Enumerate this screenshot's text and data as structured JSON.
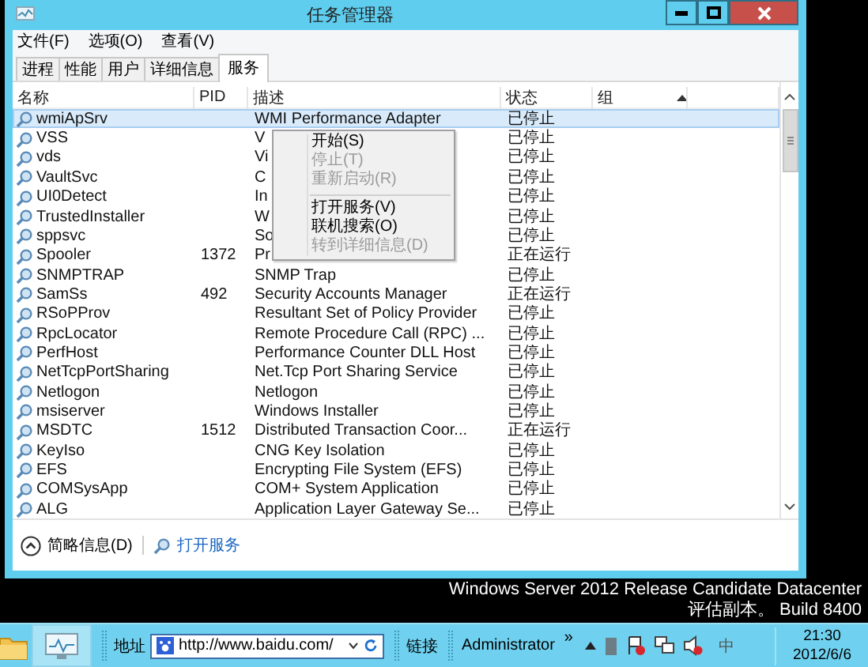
{
  "window": {
    "title": "任务管理器"
  },
  "menu": [
    "文件(F)",
    "选项(O)",
    "查看(V)"
  ],
  "tabs": [
    {
      "label": "进程",
      "selected": false
    },
    {
      "label": "性能",
      "selected": false
    },
    {
      "label": "用户",
      "selected": false
    },
    {
      "label": "详细信息",
      "selected": false
    },
    {
      "label": "服务",
      "selected": true
    }
  ],
  "table": {
    "columns": [
      {
        "label": "名称",
        "sorted": false
      },
      {
        "label": "PID",
        "sorted": false
      },
      {
        "label": "描述",
        "sorted": false
      },
      {
        "label": "状态",
        "sorted": false
      },
      {
        "label": "组",
        "sorted": true
      }
    ],
    "rows": [
      {
        "name": "wmiApSrv",
        "pid": "",
        "description": "WMI Performance Adapter",
        "status": "已停止",
        "selected": true
      },
      {
        "name": "VSS",
        "pid": "",
        "description": "V",
        "status": "已停止",
        "selected": false
      },
      {
        "name": "vds",
        "pid": "",
        "description": "Vi",
        "status": "已停止",
        "selected": false
      },
      {
        "name": "VaultSvc",
        "pid": "",
        "description": "C",
        "status": "已停止",
        "selected": false
      },
      {
        "name": "UI0Detect",
        "pid": "",
        "description": "In",
        "status": "已停止",
        "selected": false
      },
      {
        "name": "TrustedInstaller",
        "pid": "",
        "description": "W",
        "status": "已停止",
        "selected": false
      },
      {
        "name": "sppsvc",
        "pid": "",
        "description": "So",
        "status": "已停止",
        "selected": false
      },
      {
        "name": "Spooler",
        "pid": "1372",
        "description": "Pr",
        "status": "正在运行",
        "selected": false
      },
      {
        "name": "SNMPTRAP",
        "pid": "",
        "description": "SNMP Trap",
        "status": "已停止",
        "selected": false
      },
      {
        "name": "SamSs",
        "pid": "492",
        "description": "Security Accounts Manager",
        "status": "正在运行",
        "selected": false
      },
      {
        "name": "RSoPProv",
        "pid": "",
        "description": "Resultant Set of Policy Provider",
        "status": "已停止",
        "selected": false
      },
      {
        "name": "RpcLocator",
        "pid": "",
        "description": "Remote Procedure Call (RPC) ...",
        "status": "已停止",
        "selected": false
      },
      {
        "name": "PerfHost",
        "pid": "",
        "description": "Performance Counter DLL Host",
        "status": "已停止",
        "selected": false
      },
      {
        "name": "NetTcpPortSharing",
        "pid": "",
        "description": "Net.Tcp Port Sharing Service",
        "status": "已停止",
        "selected": false
      },
      {
        "name": "Netlogon",
        "pid": "",
        "description": "Netlogon",
        "status": "已停止",
        "selected": false
      },
      {
        "name": "msiserver",
        "pid": "",
        "description": "Windows Installer",
        "status": "已停止",
        "selected": false
      },
      {
        "name": "MSDTC",
        "pid": "1512",
        "description": "Distributed Transaction Coor...",
        "status": "正在运行",
        "selected": false
      },
      {
        "name": "KeyIso",
        "pid": "",
        "description": "CNG Key Isolation",
        "status": "已停止",
        "selected": false
      },
      {
        "name": "EFS",
        "pid": "",
        "description": "Encrypting File System (EFS)",
        "status": "已停止",
        "selected": false
      },
      {
        "name": "COMSysApp",
        "pid": "",
        "description": "COM+ System Application",
        "status": "已停止",
        "selected": false
      },
      {
        "name": "ALG",
        "pid": "",
        "description": "Application Layer Gateway Se...",
        "status": "已停止",
        "selected": false
      }
    ]
  },
  "context_menu": {
    "items": [
      {
        "kind": "item",
        "label": "开始(S)",
        "disabled": false
      },
      {
        "kind": "item",
        "label": "停止(T)",
        "disabled": true
      },
      {
        "kind": "item",
        "label": "重新启动(R)",
        "disabled": true
      },
      {
        "kind": "separator"
      },
      {
        "kind": "item",
        "label": "打开服务(V)",
        "disabled": false
      },
      {
        "kind": "item",
        "label": "联机搜索(O)",
        "disabled": false
      },
      {
        "kind": "item",
        "label": "转到详细信息(D)",
        "disabled": true
      }
    ]
  },
  "footer": {
    "toggle": "简略信息(D)",
    "link": "打开服务"
  },
  "desktop": {
    "lines": [
      "Windows Server 2012 Release Candidate Datacenter",
      "评估副本。 Build 8400"
    ]
  },
  "taskbar": {
    "address_label": "地址",
    "address": "http://www.baidu.com/",
    "links_label": "链接",
    "user": "Administrator",
    "chevron": "»",
    "ime": "中",
    "time": "21:30",
    "date": "2012/6/6"
  }
}
